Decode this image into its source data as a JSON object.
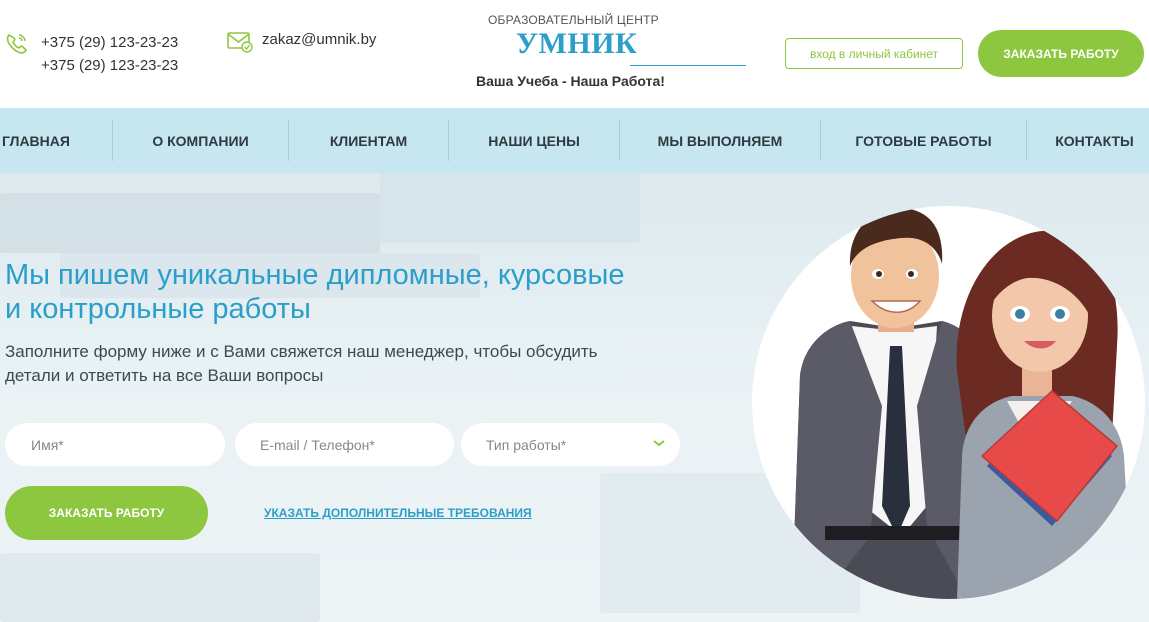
{
  "header": {
    "phones": [
      "+375 (29) 123-23-23",
      "+375 (29) 123-23-23"
    ],
    "email": "zakaz@umnik.by",
    "logo_top": "ОБРАЗОВАТЕЛЬНЫЙ ЦЕНТР",
    "logo_name": "УМНИК",
    "slogan": "Ваша Учеба - Наша Работа!",
    "login_label": "вход в личный кабинет",
    "order_label": "ЗАКАЗАТЬ РАБОТУ",
    "icons": [
      "phone-icon",
      "mail-icon"
    ]
  },
  "nav": {
    "items": [
      {
        "label": "ГЛАВНАЯ"
      },
      {
        "label": "О КОМПАНИИ"
      },
      {
        "label": "КЛИЕНТАМ"
      },
      {
        "label": "НАШИ ЦЕНЫ"
      },
      {
        "label": "МЫ ВЫПОЛНЯЕМ"
      },
      {
        "label": "ГОТОВЫЕ РАБОТЫ"
      },
      {
        "label": "КОНТАКТЫ"
      }
    ]
  },
  "hero": {
    "title_line1": "Мы пишем уникальные дипломные, курсовые",
    "title_line2": "и контрольные работы",
    "sub_line1": "Заполните форму ниже и с Вами свяжется наш менеджер, чтобы обсудить",
    "sub_line2": "детали и ответить на все Ваши вопросы",
    "form": {
      "name_placeholder": "Имя*",
      "contact_placeholder": "E-mail / Телефон*",
      "type_placeholder": "Тип работы*"
    },
    "order_label": "ЗАКАЗАТЬ РАБОТУ",
    "requirements_link": "УКАЗАТЬ ДОПОЛНИТЕЛЬНЫЕ ТРЕБОВАНИЯ"
  },
  "colors": {
    "accent_green": "#8dc63f",
    "accent_blue": "#2b9fc9",
    "nav_bg": "#c6e6f0"
  }
}
